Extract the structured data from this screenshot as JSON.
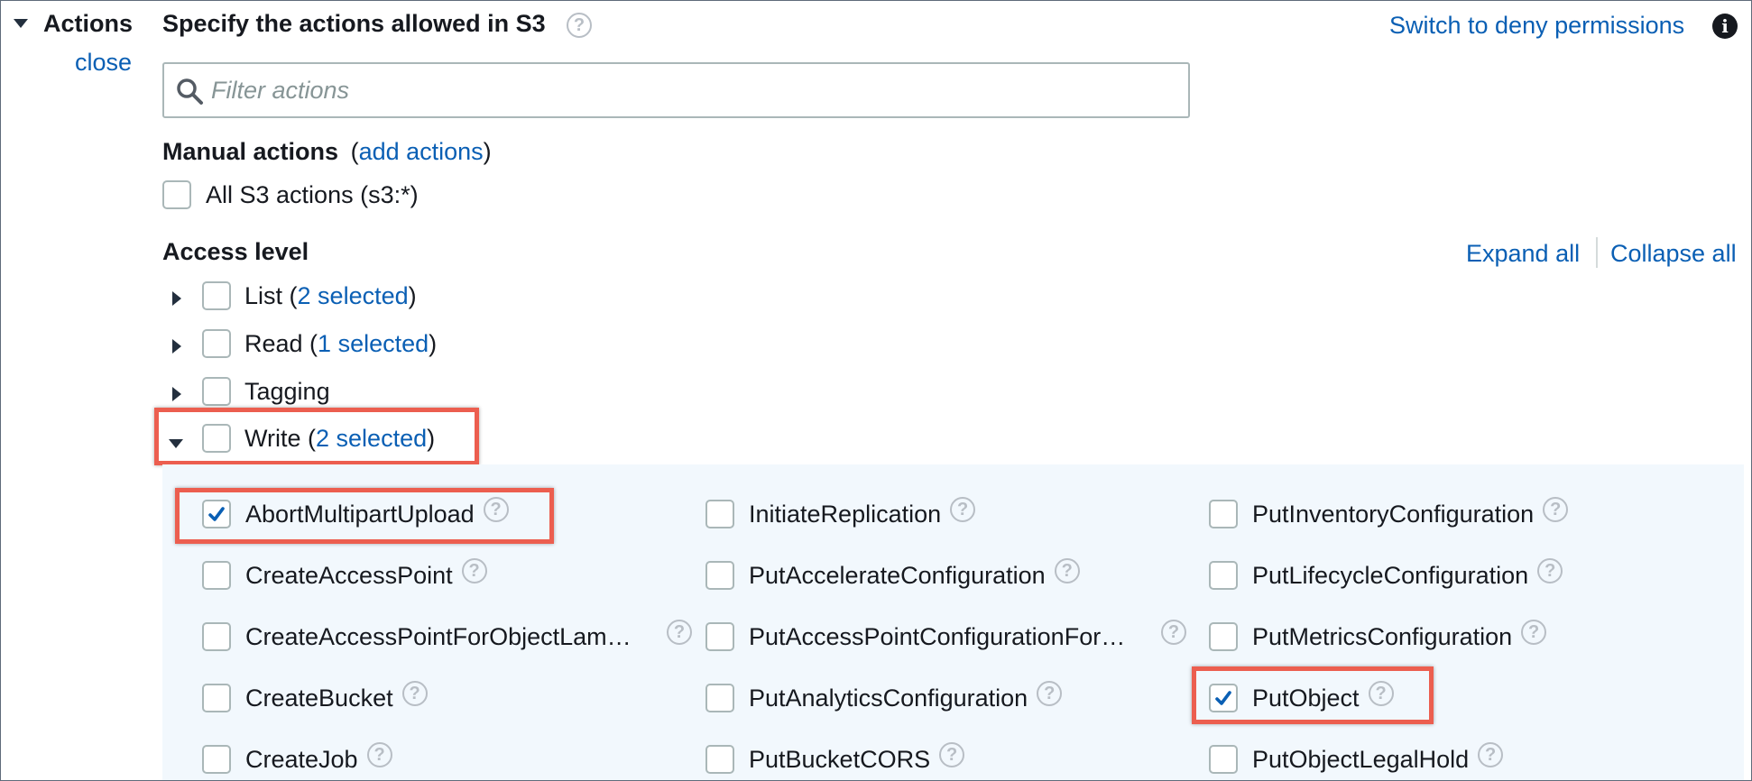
{
  "section": {
    "toggle_label": "Actions",
    "close_link": "close",
    "title": "Specify the actions allowed in S3",
    "switch_link": "Switch to deny permissions"
  },
  "filter": {
    "placeholder": "Filter actions"
  },
  "manual": {
    "heading": "Manual actions",
    "paren_open": "(",
    "add_link": "add actions",
    "paren_close": ")",
    "all_label": "All S3 actions (s3:*)"
  },
  "access": {
    "heading": "Access level",
    "expand_all": "Expand all",
    "collapse_all": "Collapse all",
    "levels": [
      {
        "label": "List",
        "selected": "2 selected",
        "expanded": false
      },
      {
        "label": "Read",
        "selected": "1 selected",
        "expanded": false
      },
      {
        "label": "Tagging",
        "selected": "",
        "expanded": false
      },
      {
        "label": "Write",
        "selected": "2 selected",
        "expanded": true
      }
    ]
  },
  "write_actions": {
    "col1": [
      {
        "label": "AbortMultipartUpload",
        "checked": true
      },
      {
        "label": "CreateAccessPoint",
        "checked": false
      },
      {
        "label": "CreateAccessPointForObjectLam…",
        "checked": false
      },
      {
        "label": "CreateBucket",
        "checked": false
      },
      {
        "label": "CreateJob",
        "checked": false
      }
    ],
    "col2": [
      {
        "label": "InitiateReplication",
        "checked": false
      },
      {
        "label": "PutAccelerateConfiguration",
        "checked": false
      },
      {
        "label": "PutAccessPointConfigurationFor…",
        "checked": false
      },
      {
        "label": "PutAnalyticsConfiguration",
        "checked": false
      },
      {
        "label": "PutBucketCORS",
        "checked": false
      }
    ],
    "col3": [
      {
        "label": "PutInventoryConfiguration",
        "checked": false
      },
      {
        "label": "PutLifecycleConfiguration",
        "checked": false
      },
      {
        "label": "PutMetricsConfiguration",
        "checked": false
      },
      {
        "label": "PutObject",
        "checked": true
      },
      {
        "label": "PutObjectLegalHold",
        "checked": false
      }
    ]
  },
  "icons": {
    "help": "?",
    "info": "i"
  },
  "colors": {
    "link": "#0a5fb4",
    "checkbox": "#0a5fb4",
    "highlight": "#ec5e4f",
    "panel": "#f2f8fd"
  }
}
